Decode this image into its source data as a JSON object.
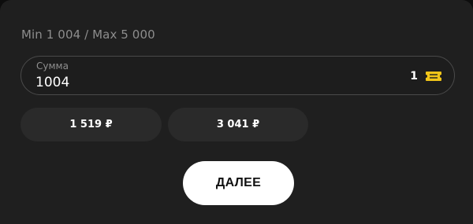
{
  "limits": {
    "text": "Min 1 004 / Max 5 000"
  },
  "amount": {
    "label": "Сумма",
    "value": "1004",
    "ticket_count": "1",
    "ticket_icon": "ticket-icon",
    "ticket_color": "#f0c419"
  },
  "presets": [
    {
      "label": "1 519 ₽"
    },
    {
      "label": "3 041 ₽"
    }
  ],
  "next_button": {
    "label": "ДАЛЕЕ"
  }
}
